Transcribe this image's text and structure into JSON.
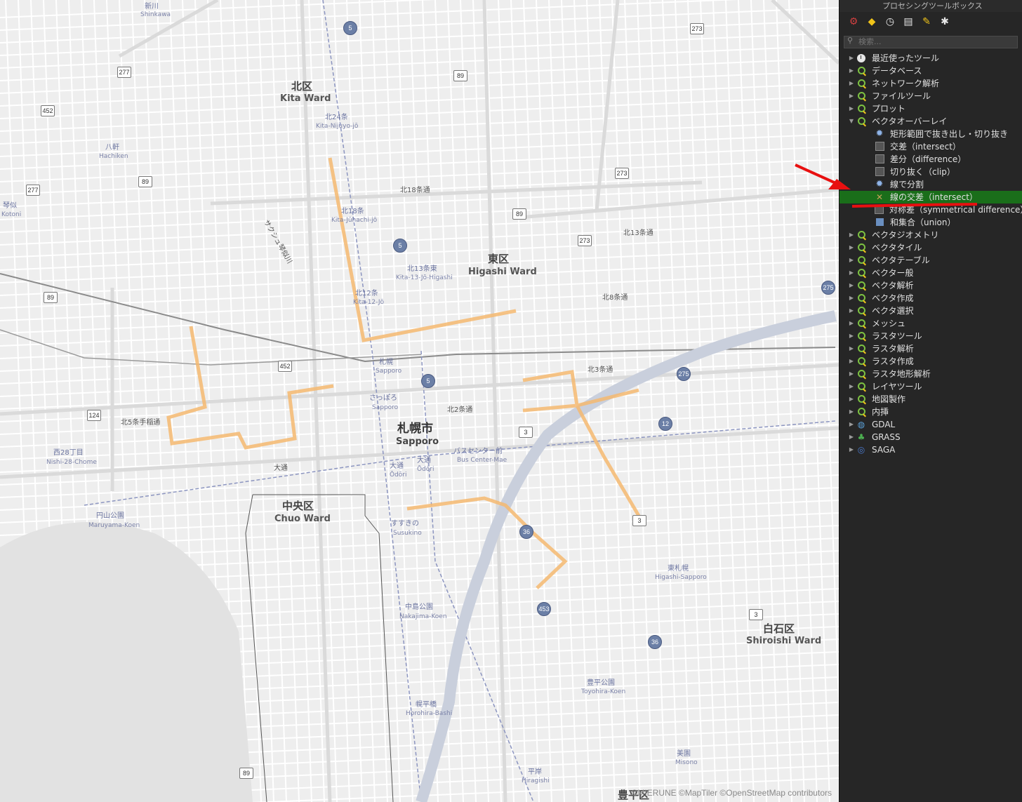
{
  "panel": {
    "title": "プロセシングツールボックス",
    "search_placeholder": "検索...",
    "toolbar": {
      "models_icon": "⚙",
      "python_icon": "◆",
      "history_icon": "◷",
      "results_icon": "▤",
      "edit_icon": "✎",
      "options_icon": "✱"
    },
    "tree": [
      {
        "label": "最近使ったツール",
        "icon": "clock",
        "expanded": false
      },
      {
        "label": "データベース",
        "icon": "q"
      },
      {
        "label": "ネットワーク解析",
        "icon": "q"
      },
      {
        "label": "ファイルツール",
        "icon": "q"
      },
      {
        "label": "プロット",
        "icon": "q"
      },
      {
        "label": "ベクタオーバーレイ",
        "icon": "q",
        "expanded": true
      },
      {
        "label": "矩形範囲で抜き出し・切り抜き",
        "icon": "gear",
        "child": true
      },
      {
        "label": "交差（intersect）",
        "icon": "dark",
        "child": true
      },
      {
        "label": "差分（difference）",
        "icon": "dark",
        "child": true
      },
      {
        "label": "切り抜く（clip）",
        "icon": "dark",
        "child": true
      },
      {
        "label": "線で分割",
        "icon": "gear",
        "child": true
      },
      {
        "label": "線の交差（intersect）",
        "icon": "line",
        "child": true,
        "selected": true
      },
      {
        "label": "対称差（symmetrical difference）",
        "icon": "dark",
        "child": true
      },
      {
        "label": "和集合（union）",
        "icon": "poly",
        "child": true
      },
      {
        "label": "ベクタジオメトリ",
        "icon": "q"
      },
      {
        "label": "ベクタタイル",
        "icon": "q"
      },
      {
        "label": "ベクタテーブル",
        "icon": "q"
      },
      {
        "label": "ベクター般",
        "icon": "q"
      },
      {
        "label": "ベクタ解析",
        "icon": "q"
      },
      {
        "label": "ベクタ作成",
        "icon": "q"
      },
      {
        "label": "ベクタ選択",
        "icon": "q"
      },
      {
        "label": "メッシュ",
        "icon": "q"
      },
      {
        "label": "ラスタツール",
        "icon": "q"
      },
      {
        "label": "ラスタ解析",
        "icon": "q"
      },
      {
        "label": "ラスタ作成",
        "icon": "q"
      },
      {
        "label": "ラスタ地形解析",
        "icon": "q"
      },
      {
        "label": "レイヤツール",
        "icon": "q"
      },
      {
        "label": "地図製作",
        "icon": "q"
      },
      {
        "label": "内挿",
        "icon": "q"
      },
      {
        "label": "GDAL",
        "icon": "gdal"
      },
      {
        "label": "GRASS",
        "icon": "grass"
      },
      {
        "label": "SAGA",
        "icon": "saga"
      }
    ]
  },
  "map": {
    "attribution": "©MIERUNE ©MapTiler ©OpenStreetMap contributors",
    "labels": {
      "kita_ward": "北区",
      "kita_ward_en": "Kita Ward",
      "higashi_ward": "東区",
      "higashi_ward_en": "Higashi Ward",
      "chuo_ward": "中央区",
      "chuo_ward_en": "Chuo Ward",
      "shiroishi_ward": "白石区",
      "shiroishi_ward_en": "Shiroishi Ward",
      "sapporo_city": "札幌市",
      "sapporo_city_en": "Sapporo",
      "toyohira": "豊平区",
      "shinkawa": "新川",
      "shinkawa_en": "Shinkawa",
      "kita24": "北24条",
      "kita24_en": "Kita-Nijuyo-jō",
      "kita18": "北18条",
      "kita18_en": "Kita-Jūhachi-jō",
      "kita12": "北12条",
      "kita12_en": "Kita-12-Jō",
      "kita13": "北13条東",
      "kita13_en": "Kita-13-Jō-Higashi",
      "sapporo_st": "札幌",
      "sapporo_st_en": "Sapporo",
      "sapporo_kana": "さっぽろ",
      "sapporo_kana_en": "Sapporo",
      "odori1": "大通",
      "odori1_en": "Ōdōri",
      "odori2": "大通",
      "odori2_en": "Ōdōri",
      "bus_center": "バスセンター前",
      "bus_center_en": "Bus Center-Mae",
      "susukino": "すすきの",
      "susukino_en": "Susukino",
      "nakajima": "中島公園",
      "nakajima_en": "Nakajima-Koen",
      "horohira": "幌平橋",
      "horohira_en": "Horohira-Bashi",
      "hiragishi": "平岸",
      "hiragishi_en": "Hiragishi",
      "nishi28": "西28丁目",
      "nishi28_en": "Nishi-28-Chome",
      "maruyama": "円山公園",
      "maruyama_en": "Maruyama-Koen",
      "hachiken": "八軒",
      "hachiken_en": "Hachiken",
      "kotoni": "琴似",
      "kotoni_en": "Kotoni",
      "higashi_sapporo": "東札幌",
      "higashi_sapporo_en": "Higashi-Sapporo",
      "toyohira_park": "豊平公園",
      "toyohira_park_en": "Toyohira-Koen",
      "misono": "美園",
      "misono_en": "Misono",
      "kita18_street": "北18条通",
      "kita13_street": "北13条通",
      "kita8_street": "北8条通",
      "kita3_street": "北3条通",
      "kita2_street": "北2条通",
      "kita5_street": "北5条手稲通",
      "odori_street": "大通",
      "sakushu": "サクシュ琴似川"
    },
    "routes": [
      "5",
      "5",
      "5",
      "89",
      "89",
      "89",
      "89",
      "89",
      "273",
      "273",
      "273",
      "277",
      "277",
      "452",
      "452",
      "124",
      "3",
      "3",
      "3",
      "12",
      "36",
      "36",
      "275",
      "275",
      "453"
    ]
  },
  "colors": {
    "selected_row": "#1a6e1a",
    "highlight_line": "#f5b870",
    "annotation_red": "#e81010"
  }
}
